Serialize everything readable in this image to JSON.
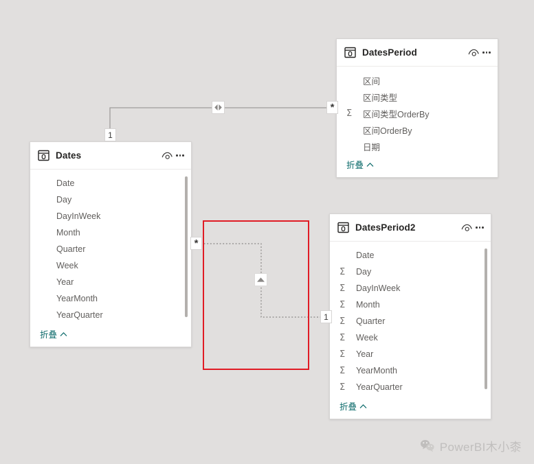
{
  "view": {
    "name": "model-relationship-view",
    "background_color": "#e1dfde",
    "card_color": "#ffffff",
    "selection_color": "#e01b24",
    "link_color": "#0b6a6a",
    "collapse_label": "折叠"
  },
  "tables": [
    {
      "id": "DatesPeriod",
      "title": "DatesPeriod",
      "icon": "table-icon",
      "eye_icon": "hide-eye-icon",
      "menu_icon": "more-options-icon",
      "has_scrollbar": false,
      "fields": [
        {
          "name": "区间",
          "measure": false
        },
        {
          "name": "区间类型",
          "measure": false
        },
        {
          "name": "区间类型OrderBy",
          "measure": true
        },
        {
          "name": "区间OrderBy",
          "measure": false
        },
        {
          "name": "日期",
          "measure": false
        }
      ]
    },
    {
      "id": "Dates",
      "title": "Dates",
      "icon": "table-icon",
      "eye_icon": "hide-eye-icon",
      "menu_icon": "more-options-icon",
      "has_scrollbar": true,
      "fields": [
        {
          "name": "Date",
          "measure": false
        },
        {
          "name": "Day",
          "measure": false
        },
        {
          "name": "DayInWeek",
          "measure": false
        },
        {
          "name": "Month",
          "measure": false
        },
        {
          "name": "Quarter",
          "measure": false
        },
        {
          "name": "Week",
          "measure": false
        },
        {
          "name": "Year",
          "measure": false
        },
        {
          "name": "YearMonth",
          "measure": false
        },
        {
          "name": "YearQuarter",
          "measure": false
        }
      ]
    },
    {
      "id": "DatesPeriod2",
      "title": "DatesPeriod2",
      "icon": "table-icon",
      "eye_icon": "hide-eye-icon",
      "menu_icon": "more-options-icon",
      "has_scrollbar": true,
      "fields": [
        {
          "name": "Date",
          "measure": false
        },
        {
          "name": "Day",
          "measure": true
        },
        {
          "name": "DayInWeek",
          "measure": true
        },
        {
          "name": "Month",
          "measure": true
        },
        {
          "name": "Quarter",
          "measure": true
        },
        {
          "name": "Week",
          "measure": true
        },
        {
          "name": "Year",
          "measure": true
        },
        {
          "name": "YearMonth",
          "measure": true
        },
        {
          "name": "YearQuarter",
          "measure": true
        }
      ]
    }
  ],
  "relationships": [
    {
      "id": "dates-to-datesperiod",
      "style": "solid",
      "state": "active",
      "from_table": "Dates",
      "from_cardinality": "1",
      "to_table": "DatesPeriod",
      "to_cardinality": "*",
      "cross_filter": "both",
      "cross_filter_icon": "bidirectional-arrow-icon"
    },
    {
      "id": "dates-to-datesperiod2",
      "style": "dotted",
      "state": "inactive",
      "from_table": "Dates",
      "from_cardinality": "*",
      "to_table": "DatesPeriod2",
      "to_cardinality": "1",
      "cross_filter": "single",
      "cross_filter_icon": "up-arrow-icon"
    }
  ],
  "watermark": {
    "icon": "wechat-icon",
    "text": "PowerBI木小桼"
  },
  "sigma_glyph": "Σ",
  "chevron_glyph": "⌃"
}
